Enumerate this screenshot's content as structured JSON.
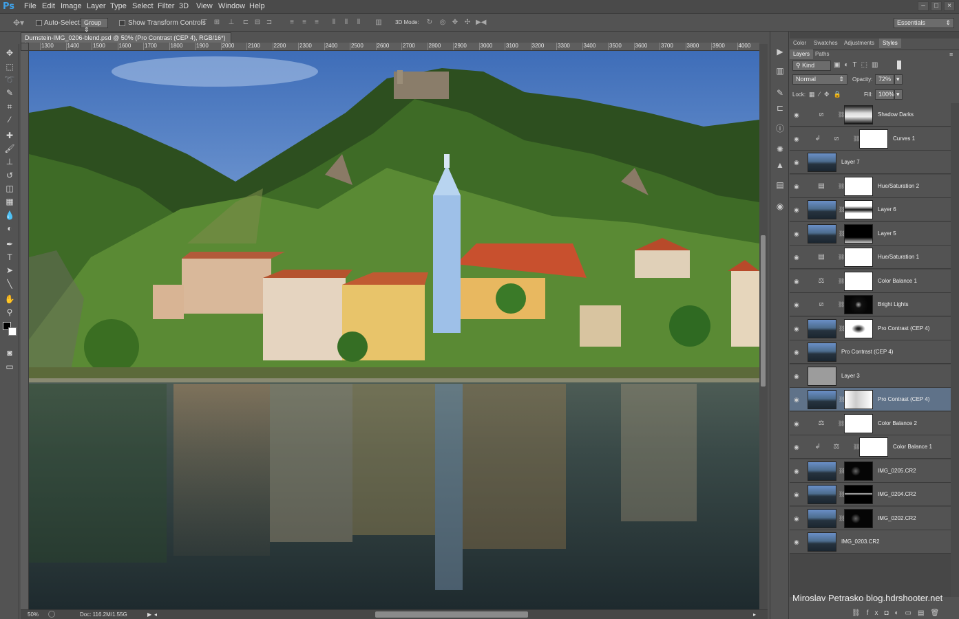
{
  "app": {
    "logo": "Ps"
  },
  "menu": [
    "File",
    "Edit",
    "Image",
    "Layer",
    "Type",
    "Select",
    "Filter",
    "3D",
    "View",
    "Window",
    "Help"
  ],
  "options_bar": {
    "auto_select_label": "Auto-Select:",
    "auto_select_value": "Group",
    "show_transform_label": "Show Transform Controls",
    "mode_3d_label": "3D Mode:",
    "workspace": "Essentials"
  },
  "document": {
    "tab_title": "Durnstein-IMG_0206-blend.psd @ 50% (Pro Contrast (CEP 4), RGB/16*) *",
    "ruler_ticks": [
      "1300",
      "1400",
      "1500",
      "1600",
      "1700",
      "1800",
      "1900",
      "2000",
      "2100",
      "2200",
      "2300",
      "2400",
      "2500",
      "2600",
      "2700",
      "2800",
      "2900",
      "3000",
      "3100",
      "3200",
      "3300",
      "3400",
      "3500",
      "3600",
      "3700",
      "3800",
      "3900",
      "4000"
    ],
    "zoom": "50%",
    "doc_size": "Doc: 116.2M/1.55G"
  },
  "panels": {
    "top_tabs": [
      "Color",
      "Swatches",
      "Adjustments",
      "Styles"
    ],
    "layer_tabs": [
      "Layers",
      "Paths"
    ],
    "filter_kind": "Kind",
    "blend_mode": "Normal",
    "opacity_label": "Opacity:",
    "opacity_value": "72%",
    "lock_label": "Lock:",
    "fill_label": "Fill:",
    "fill_value": "100%",
    "layers": [
      {
        "name": "Shadow Darks",
        "type": "adjustment",
        "icon": "curves-icon",
        "mask": "shadow"
      },
      {
        "name": "Curves 1",
        "type": "adjustment-clipped",
        "icon": "curves-icon",
        "mask": "white"
      },
      {
        "name": "Layer 7",
        "type": "image"
      },
      {
        "name": "Hue/Saturation 2",
        "type": "adjustment",
        "icon": "hue-icon",
        "mask": "white"
      },
      {
        "name": "Layer 6",
        "type": "image-mask",
        "mask": "band"
      },
      {
        "name": "Layer 5",
        "type": "image-mask",
        "mask": "black-top"
      },
      {
        "name": "Hue/Saturation 1",
        "type": "adjustment",
        "icon": "hue-icon",
        "mask": "white"
      },
      {
        "name": "Color Balance 1",
        "type": "adjustment",
        "icon": "balance-icon",
        "mask": "white"
      },
      {
        "name": "Bright Lights",
        "type": "adjustment",
        "icon": "curves-icon",
        "mask": "black"
      },
      {
        "name": "Pro Contrast (CEP 4)",
        "type": "image-mask",
        "mask": "splash"
      },
      {
        "name": "Pro Contrast (CEP 4)",
        "type": "image"
      },
      {
        "name": "Layer 3",
        "type": "gray"
      },
      {
        "name": "Pro Contrast (CEP 4)",
        "type": "image-mask",
        "mask": "soft",
        "selected": true
      },
      {
        "name": "Color Balance 2",
        "type": "adjustment",
        "icon": "balance-icon",
        "mask": "white"
      },
      {
        "name": "Color Balance 1",
        "type": "adjustment-clipped",
        "icon": "balance-icon",
        "mask": "white"
      },
      {
        "name": "IMG_0205.CR2",
        "type": "image-mask",
        "mask": "black"
      },
      {
        "name": "IMG_0204.CR2",
        "type": "image-mask",
        "mask": "black-line"
      },
      {
        "name": "IMG_0202.CR2",
        "type": "image-mask",
        "mask": "black"
      },
      {
        "name": "IMG_0203.CR2",
        "type": "image"
      }
    ]
  },
  "watermark": "Miroslav  Petrasko  blog.hdrshooter.net"
}
